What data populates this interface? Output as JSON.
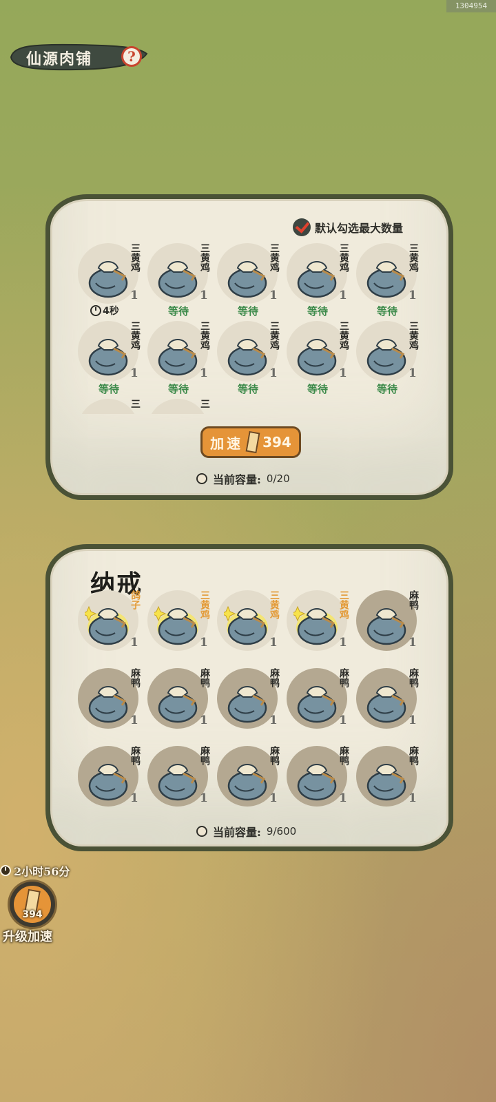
{
  "corner_id": "1304954",
  "header": {
    "title": "仙源肉铺",
    "help_icon": "?"
  },
  "shop": {
    "default_select_label": "默认勾选最大数量",
    "slots": [
      {
        "name": "三黄鸡",
        "qty": "1",
        "status": "4秒",
        "status_type": "timer"
      },
      {
        "name": "三黄鸡",
        "qty": "1",
        "status": "等待",
        "status_type": "wait"
      },
      {
        "name": "三黄鸡",
        "qty": "1",
        "status": "等待",
        "status_type": "wait"
      },
      {
        "name": "三黄鸡",
        "qty": "1",
        "status": "等待",
        "status_type": "wait"
      },
      {
        "name": "三黄鸡",
        "qty": "1",
        "status": "等待",
        "status_type": "wait"
      },
      {
        "name": "三黄鸡",
        "qty": "1",
        "status": "等待",
        "status_type": "wait"
      },
      {
        "name": "三黄鸡",
        "qty": "1",
        "status": "等待",
        "status_type": "wait"
      },
      {
        "name": "三黄鸡",
        "qty": "1",
        "status": "等待",
        "status_type": "wait"
      },
      {
        "name": "三黄鸡",
        "qty": "1",
        "status": "等待",
        "status_type": "wait"
      },
      {
        "name": "三黄鸡",
        "qty": "1",
        "status": "等待",
        "status_type": "wait"
      },
      {
        "name": "三",
        "qty": "",
        "status": "",
        "status_type": "none"
      },
      {
        "name": "三",
        "qty": "",
        "status": "",
        "status_type": "none"
      }
    ],
    "speed_up_label": "加速",
    "speed_up_cost": "394",
    "capacity_label": "当前容量:",
    "capacity_value": "0/20"
  },
  "ring": {
    "title": "纳戒",
    "slots": [
      {
        "name": "鸽子",
        "qty": "1",
        "highlight": true
      },
      {
        "name": "三黄鸡",
        "qty": "1",
        "highlight": true
      },
      {
        "name": "三黄鸡",
        "qty": "1",
        "highlight": true
      },
      {
        "name": "三黄鸡",
        "qty": "1",
        "highlight": true
      },
      {
        "name": "麻鸭",
        "qty": "1",
        "highlight": false
      },
      {
        "name": "麻鸭",
        "qty": "1",
        "highlight": false
      },
      {
        "name": "麻鸭",
        "qty": "1",
        "highlight": false
      },
      {
        "name": "麻鸭",
        "qty": "1",
        "highlight": false
      },
      {
        "name": "麻鸭",
        "qty": "1",
        "highlight": false
      },
      {
        "name": "麻鸭",
        "qty": "1",
        "highlight": false
      },
      {
        "name": "麻鸭",
        "qty": "1",
        "highlight": false
      },
      {
        "name": "麻鸭",
        "qty": "1",
        "highlight": false
      },
      {
        "name": "麻鸭",
        "qty": "1",
        "highlight": false
      },
      {
        "name": "麻鸭",
        "qty": "1",
        "highlight": false
      },
      {
        "name": "麻鸭",
        "qty": "1",
        "highlight": false
      }
    ],
    "capacity_label": "当前容量:",
    "capacity_value": "9/600"
  },
  "upgrade": {
    "timer": "2小时56分",
    "cost": "394",
    "label": "升级加速"
  },
  "colors": {
    "accent_orange": "#e59438",
    "wait_green": "#3c8a4a",
    "highlight_name": "#e39a37",
    "panel_border": "#4a5236"
  }
}
